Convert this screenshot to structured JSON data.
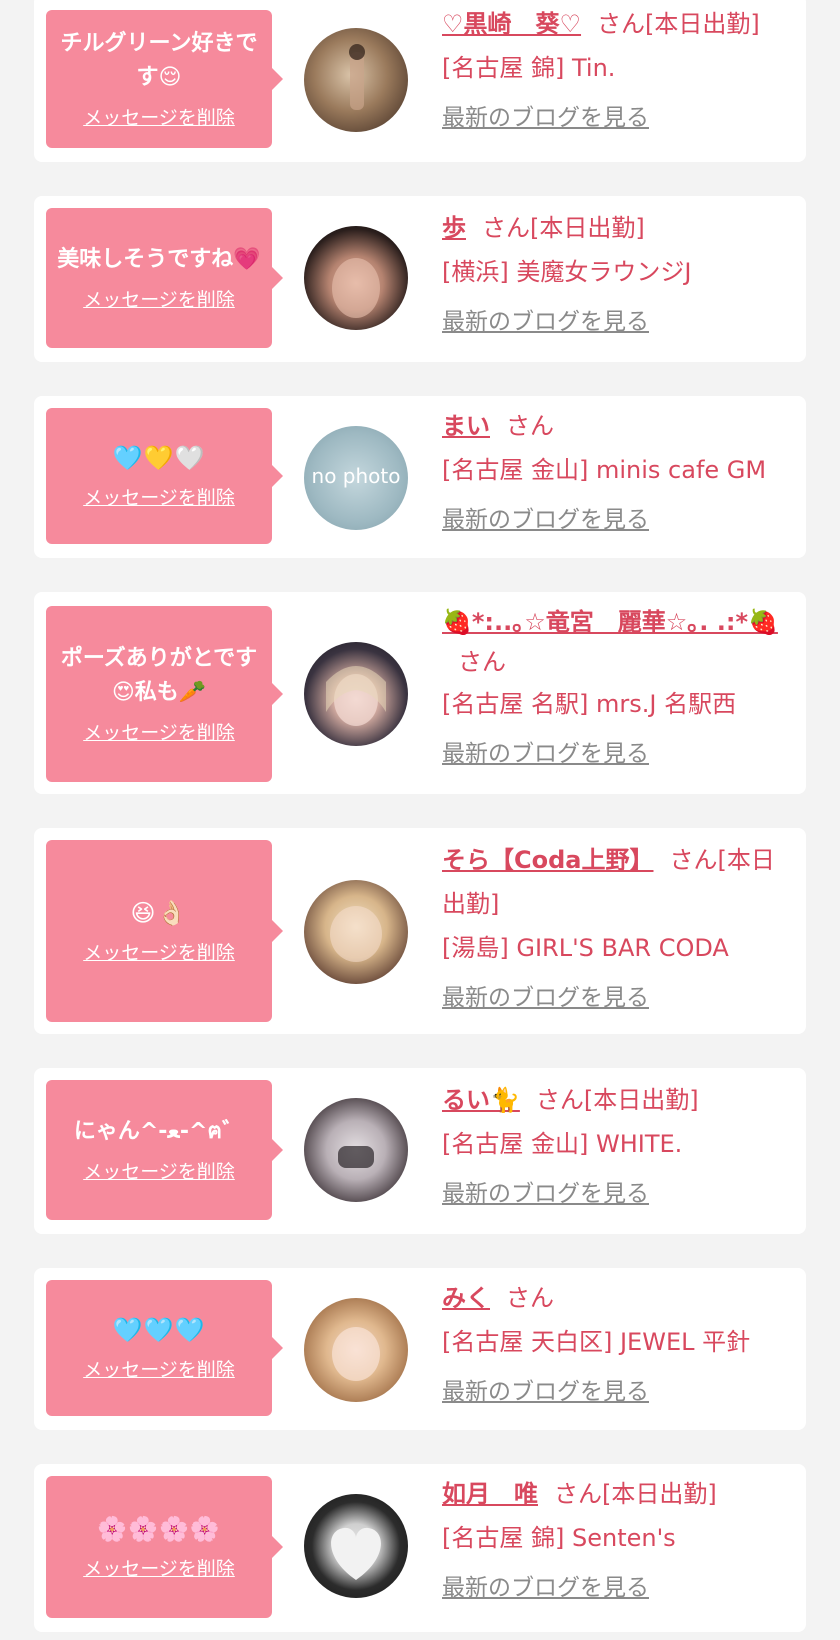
{
  "colors": {
    "background": "#f3f3f3",
    "card": "#ffffff",
    "bubble": "#f68a9c",
    "accent": "#d8485e",
    "link_gray": "#8a8a8a"
  },
  "labels": {
    "delete": "メッセージを削除",
    "blog": "最新のブログを見る",
    "honorific": "さん"
  },
  "entries": [
    {
      "message": "チルグリーン好きです😌",
      "name": "♡黒崎　葵♡",
      "status": "[本日出勤]",
      "shop": "[名古屋 錦] Tin.",
      "avatar": "photo-avatar"
    },
    {
      "message": "美味しそうですね💗",
      "name": "歩",
      "status": "[本日出勤]",
      "shop": "[横浜] 美魔女ラウンジJ",
      "avatar": "photo-avatar"
    },
    {
      "message": "🩵💛🤍",
      "name": "まい",
      "status": "",
      "shop": "[名古屋 金山] minis cafe GM",
      "avatar": "no-photo-avatar",
      "no_photo_label": "no photo"
    },
    {
      "message": "ポーズありがとです😍私も🥕",
      "name": "🍓*:..｡☆竜宮　麗華☆｡. .:*🍓",
      "status": "",
      "shop": "[名古屋 名駅] mrs.J 名駅西",
      "avatar": "photo-avatar"
    },
    {
      "message": "😆👌🏻",
      "name": "そら【Coda上野】",
      "status": "[本日出勤]",
      "shop": "[湯島] GIRL'S BAR CODA",
      "avatar": "photo-avatar"
    },
    {
      "message": "にゃん^-ﻌ-^ฅ゛",
      "name": "るい🐈",
      "status": "[本日出勤]",
      "shop": "[名古屋 金山] WHITE.",
      "avatar": "photo-avatar"
    },
    {
      "message": "🩵🩵🩵",
      "name": "みく",
      "status": "",
      "shop": "[名古屋 天白区] JEWEL 平針",
      "avatar": "photo-avatar"
    },
    {
      "message": "🌸🌸🌸🌸",
      "name": "如月　唯",
      "status": "[本日出勤]",
      "shop": "[名古屋 錦] Senten's",
      "avatar": "photo-avatar"
    }
  ]
}
